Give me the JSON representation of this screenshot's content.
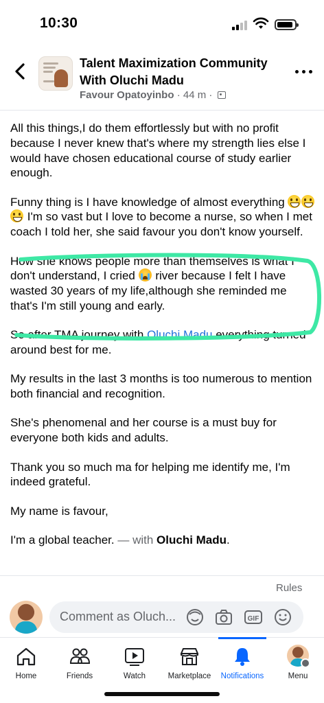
{
  "status_bar": {
    "time": "10:30"
  },
  "header": {
    "title": "Talent Maximization Community With Oluchi Madu",
    "author": "Favour Opatoyinbo",
    "separator": "·",
    "time_ago": "44 m",
    "audience_icon": "group-audience-icon",
    "back_icon": "back-chevron-icon",
    "more_icon": "more-horizontal-icon"
  },
  "post": {
    "p1": "All this things,I do them effortlessly but with no profit because I never knew that's where my strength lies else I would have chosen educational course of study earlier enough.",
    "p2_a": "Funny thing is I have knowledge of almost everything",
    "p2_b": " I'm so vast but I love to become a nurse, so when I met coach I told her, she said favour you don't know yourself.",
    "p3_a": "How she knows people more than themselves is what I don't understand, I cried",
    "p3_b": " river because I felt I have wasted 30 years of my life,although she reminded me that's I'm still young and early.",
    "p4_a": "So  after TMA journey  with ",
    "p4_link": "Oluchi Madu",
    "p4_b": "  everything turned around best for me.",
    "p5": "My results in the last 3 months is too numerous to mention both financial and recognition.",
    "p6": "She's phenomenal and her course is a must buy for everyone both kids and adults.",
    "p7": "Thank you so much ma for helping me identify me, I'm indeed grateful.",
    "p8": "My name is favour,",
    "p9_a": "I'm a global teacher. ",
    "p9_with": "— with ",
    "p9_name": "Oluchi Madu",
    "p9_end": "."
  },
  "composer": {
    "rules": "Rules",
    "placeholder": "Comment as Oluch...",
    "icons": [
      "avatar-sticker-icon",
      "camera-icon",
      "gif-icon",
      "emoji-icon"
    ]
  },
  "tabs": [
    {
      "label": "Home",
      "icon": "home-icon"
    },
    {
      "label": "Friends",
      "icon": "friends-icon"
    },
    {
      "label": "Watch",
      "icon": "watch-icon"
    },
    {
      "label": "Marketplace",
      "icon": "marketplace-icon"
    },
    {
      "label": "Notifications",
      "icon": "bell-icon",
      "active": true
    },
    {
      "label": "Menu",
      "icon": "profile-avatar"
    }
  ],
  "colors": {
    "accent": "#0866ff",
    "link": "#216fdb",
    "highlight_marker": "#3ee8a5",
    "secondary_text": "#65676b"
  }
}
